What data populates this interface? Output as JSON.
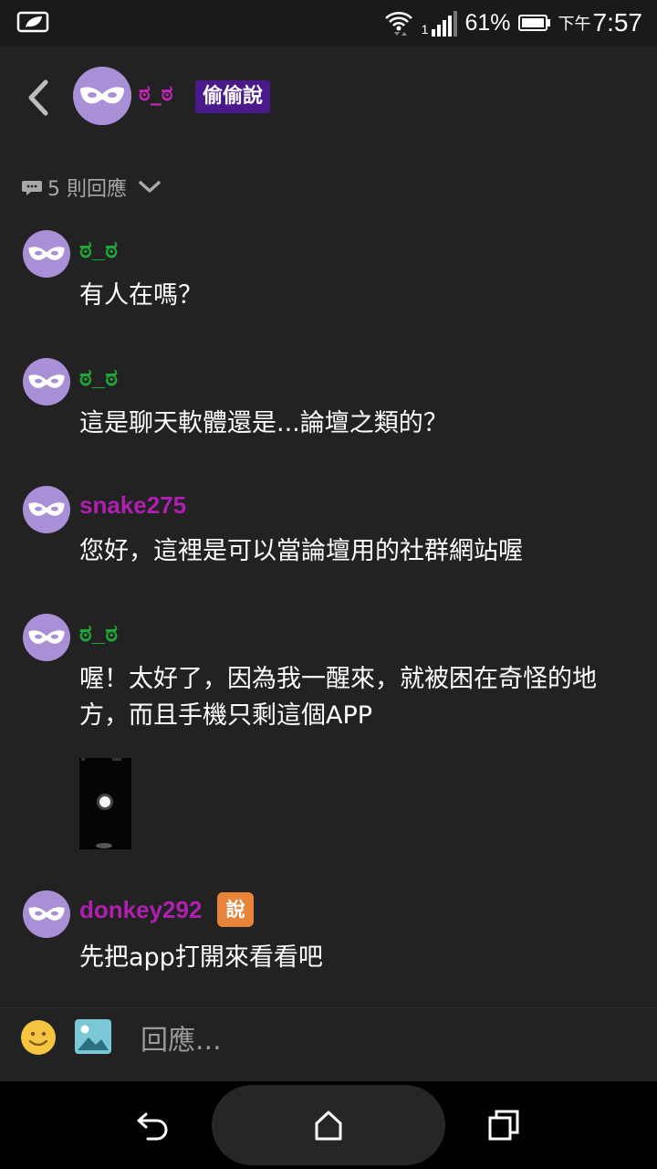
{
  "status_bar": {
    "battery_percent": "61%",
    "time_prefix": "下午",
    "time": "7:57",
    "signal_sim": "1"
  },
  "header": {
    "username": "ಠ_ಠ",
    "tag": "偷偷說",
    "avatar_icon": "mask-icon",
    "back_icon": "chevron-left-icon"
  },
  "replies": {
    "count_label": "5 則回應"
  },
  "comments": [
    {
      "username": "ಠ_ಠ",
      "text": "有人在嗎？"
    },
    {
      "username": "ಠ_ಠ",
      "text": "這是聊天軟體還是...論壇之類的？"
    },
    {
      "username": "snake275",
      "text": "您好，這裡是可以當論壇用的社群網站喔"
    },
    {
      "username": "ಠ_ಠ",
      "text": "喔！太好了，因為我一醒來，就被困在奇怪的地方，而且手機只剩這個APP"
    },
    {
      "username": "donkey292",
      "badge": "說",
      "text": "先把app打開來看看吧"
    }
  ],
  "composer": {
    "placeholder": "回應..."
  },
  "colors": {
    "background": "#222222",
    "green_name": "#1fa33a",
    "purple_name": "#b01fb0",
    "tag_bg": "#4b1a8a",
    "badge_bg": "#e8833a",
    "avatar": "#a98fd6"
  }
}
